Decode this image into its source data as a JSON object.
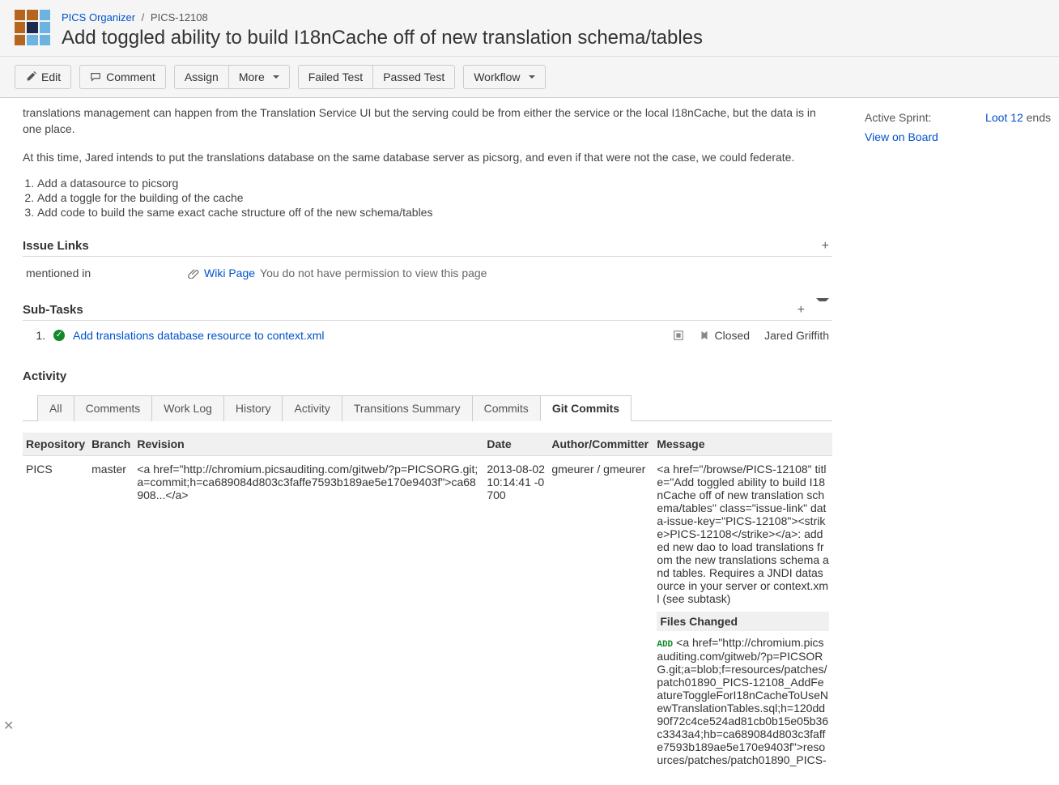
{
  "breadcrumb": {
    "project": "PICS Organizer",
    "key": "PICS-12108"
  },
  "title": "Add toggled ability to build I18nCache off of new translation schema/tables",
  "toolbar": {
    "edit": "Edit",
    "comment": "Comment",
    "assign": "Assign",
    "more": "More",
    "failed": "Failed Test",
    "passed": "Passed Test",
    "workflow": "Workflow"
  },
  "description": {
    "p1": "translations management can happen from the Translation Service UI but the serving could be from either the service or the local I18nCache, but the data is in one place.",
    "p2": "At this time, Jared intends to put the translations database on the same database server as picsorg, and even if that were not the case, we could federate.",
    "items": [
      "Add a datasource to picsorg",
      "Add a toggle for the building of the cache",
      "Add code to build the same exact cache structure off of the new schema/tables"
    ]
  },
  "sections": {
    "issueLinks": "Issue Links",
    "subTasks": "Sub-Tasks",
    "activity": "Activity"
  },
  "issueLink": {
    "type": "mentioned in",
    "target": "Wiki Page",
    "note": "You do not have permission to view this page"
  },
  "subtask": {
    "num": "1.",
    "title": "Add translations database resource to context.xml",
    "status": "Closed",
    "assignee": "Jared Griffith"
  },
  "activityTabs": {
    "all": "All",
    "comments": "Comments",
    "worklog": "Work Log",
    "history": "History",
    "activity": "Activity",
    "transitions": "Transitions Summary",
    "commits": "Commits",
    "gitcommits": "Git Commits"
  },
  "gitTable": {
    "headers": {
      "repo": "Repository",
      "branch": "Branch",
      "revision": "Revision",
      "date": "Date",
      "author": "Author/Committer",
      "message": "Message"
    },
    "row": {
      "repo": "PICS",
      "branch": "master",
      "revision": "<a href=\"http://chromium.picsauditing.com/gitweb/?p=PICSORG.git;a=commit;h=ca689084d803c3faffe7593b189ae5e170e9403f\">ca68908...</a>",
      "date": "2013-08-02 10:14:41 -0700",
      "author": "gmeurer / gmeurer",
      "message": "<a href=\"/browse/PICS-12108\" title=\"Add toggled ability to build I18nCache off of new translation schema/tables\" class=\"issue-link\" data-issue-key=\"PICS-12108\"><strike>PICS-12108</strike></a>: added new dao to load translations from the new translations schema and tables. Requires a JNDI datasource in your server or context.xml (see subtask)",
      "filesHeader": "Files Changed",
      "addTag": "ADD",
      "fileLine": "<a href=\"http://chromium.picsauditing.com/gitweb/?p=PICSORG.git;a=blob;f=resources/patches/patch01890_PICS-12108_AddFeatureToggleForI18nCacheToUseNewTranslationTables.sql;h=120dd90f72c4ce524ad81cb0b15e05b36c3343a4;hb=ca689084d803c3faffe7593b189ae5e170e9403f\">resources/patches/patch01890_PICS-"
    }
  },
  "sidebar": {
    "sprintLabel": "Active Sprint:",
    "sprintValue": "Loot 12",
    "sprintEnds": "ends",
    "boardLink": "View on Board"
  }
}
